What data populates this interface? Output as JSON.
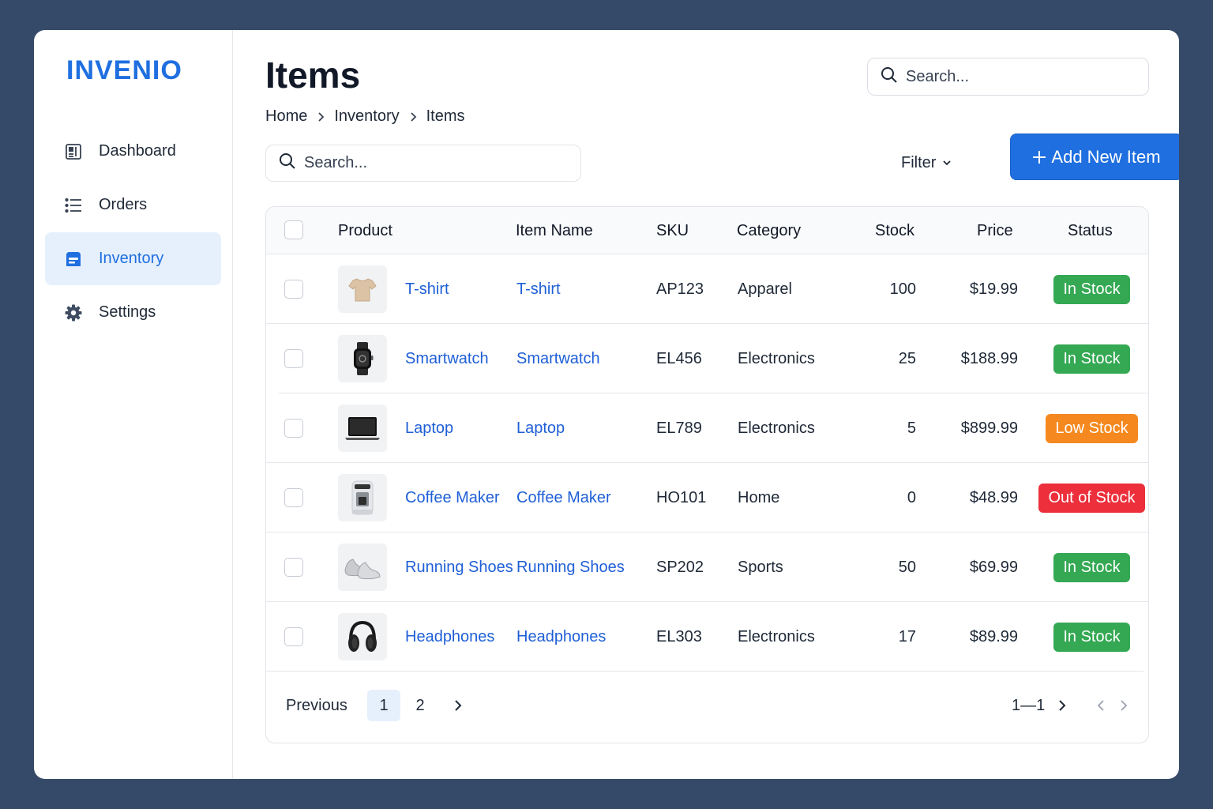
{
  "app": {
    "logo": "INVENIO"
  },
  "sidebar": {
    "items": [
      {
        "label": "Dashboard",
        "icon": "dashboard-icon",
        "active": false
      },
      {
        "label": "Orders",
        "icon": "list-icon",
        "active": false
      },
      {
        "label": "Inventory",
        "icon": "inventory-box-icon",
        "active": true
      },
      {
        "label": "Settings",
        "icon": "gear-icon",
        "active": false
      }
    ]
  },
  "header": {
    "title": "Items",
    "breadcrumb": [
      "Home",
      "Inventory",
      "Items"
    ],
    "search_placeholder": "Search..."
  },
  "toolbar": {
    "search_placeholder": "Search...",
    "filter_label": "Filter",
    "add_label": "Add New Item"
  },
  "table": {
    "columns": [
      "Product",
      "Item Name",
      "SKU",
      "Category",
      "Stock",
      "Price",
      "Status"
    ],
    "rows": [
      {
        "product": "T-shirt",
        "item_name": "T-shirt",
        "sku": "AP123",
        "category": "Apparel",
        "stock": "100",
        "price": "$19.99",
        "status": "In Stock",
        "thumb": "tshirt-icon"
      },
      {
        "product": "Smartwatch",
        "item_name": "Smartwatch",
        "sku": "EL456",
        "category": "Electronics",
        "stock": "25",
        "price": "$188.99",
        "status": "In Stock",
        "thumb": "smartwatch-icon"
      },
      {
        "product": "Laptop",
        "item_name": "Laptop",
        "sku": "EL789",
        "category": "Electronics",
        "stock": "5",
        "price": "$899.99",
        "status": "Low Stock",
        "thumb": "laptop-icon"
      },
      {
        "product": "Coffee Maker",
        "item_name": "Coffee Maker",
        "sku": "HO101",
        "category": "Home",
        "stock": "0",
        "price": "$48.99",
        "status": "Out of Stock",
        "thumb": "coffee-maker-icon"
      },
      {
        "product": "Running Shoes",
        "item_name": "Running Shoes",
        "sku": "SP202",
        "category": "Sports",
        "stock": "50",
        "price": "$69.99",
        "status": "In Stock",
        "thumb": "shoes-icon"
      },
      {
        "product": "Headphones",
        "item_name": "Headphones",
        "sku": "EL303",
        "category": "Electronics",
        "stock": "17",
        "price": "$89.99",
        "status": "In Stock",
        "thumb": "headphones-icon"
      }
    ]
  },
  "status_colors": {
    "In Stock": "#34a853",
    "Low Stock": "#f5891f",
    "Out of Stock": "#ec2f3b"
  },
  "pagination": {
    "previous_label": "Previous",
    "pages": [
      "1",
      "2"
    ],
    "current_page": "1",
    "range_label": "1—1"
  },
  "colors": {
    "accent": "#1f6fe0",
    "background": "#354a68"
  }
}
